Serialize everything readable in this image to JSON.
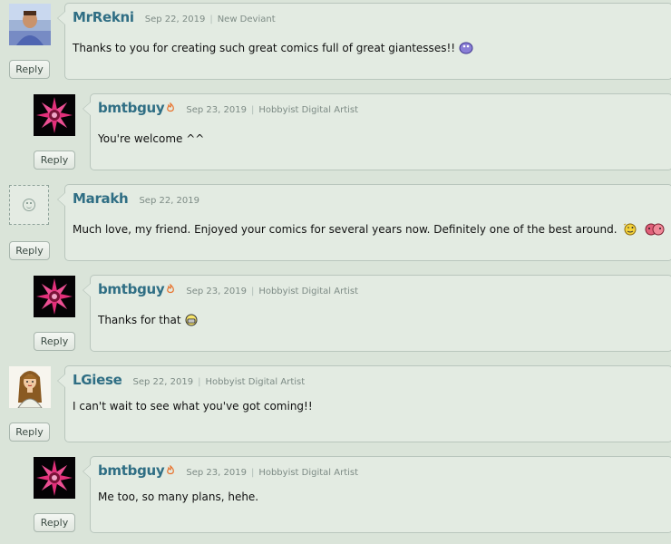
{
  "reply_label": "Reply",
  "comments": [
    {
      "username": "MrRekni",
      "date": "Sep 22, 2019",
      "role": "New Deviant",
      "text": "Thanks to you for creating such great comics full of great giantesses!!",
      "avatar": "photo-avatar-icon",
      "indent": false
    },
    {
      "username": "bmtbguy",
      "date": "Sep 23, 2019",
      "role": "Hobbyist Digital Artist",
      "text": "You're welcome ^^",
      "avatar": "pink-flower-avatar-icon",
      "indent": true
    },
    {
      "username": "Marakh",
      "date": "Sep 22, 2019",
      "role": "",
      "text": "Much love, my friend. Enjoyed your comics for several years now. Definitely one of the best around.",
      "avatar": "default-avatar-icon",
      "indent": false
    },
    {
      "username": "bmtbguy",
      "date": "Sep 23, 2019",
      "role": "Hobbyist Digital Artist",
      "text": "Thanks for that",
      "avatar": "pink-flower-avatar-icon",
      "indent": true
    },
    {
      "username": "LGiese",
      "date": "Sep 22, 2019",
      "role": "Hobbyist Digital Artist",
      "text": "I can't wait to see what you've got coming!!",
      "avatar": "cartoon-woman-avatar-icon",
      "indent": false
    },
    {
      "username": "bmtbguy",
      "date": "Sep 23, 2019",
      "role": "Hobbyist Digital Artist",
      "text": "Me too, so many plans, hehe.",
      "avatar": "pink-flower-avatar-icon",
      "indent": true
    }
  ],
  "colors": {
    "background": "#dae4d9",
    "bubble": "#e3ebe2",
    "username": "#2f6e84",
    "meta": "#7d8b85"
  }
}
